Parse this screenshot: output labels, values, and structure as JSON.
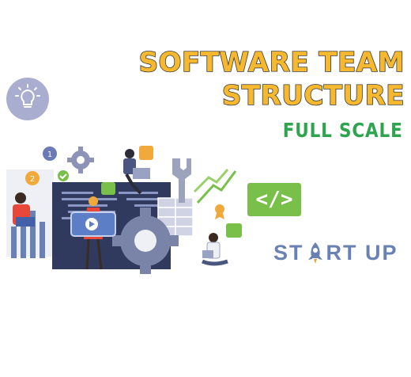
{
  "title_line1": "SOFTWARE TEAM",
  "title_line2": "STRUCTURE",
  "subtitle": "FULL SCALE",
  "logo": {
    "part1": "ST",
    "part2": "RT UP"
  },
  "code_badge": "</>",
  "badges": {
    "one": "1",
    "two": "2"
  },
  "colors": {
    "title": "#f5b82e",
    "subtitle": "#2ea44f",
    "accent_blue": "#6a82b3",
    "accent_green": "#79c04a",
    "bulb_circle": "#a9aed0"
  },
  "icons": [
    "lightbulb-icon",
    "gear-icon",
    "wrench-icon",
    "key-icon",
    "code-icon",
    "rocket-icon",
    "check-icon",
    "medal-icon",
    "stopwatch-icon",
    "percent-icon",
    "play-icon"
  ]
}
